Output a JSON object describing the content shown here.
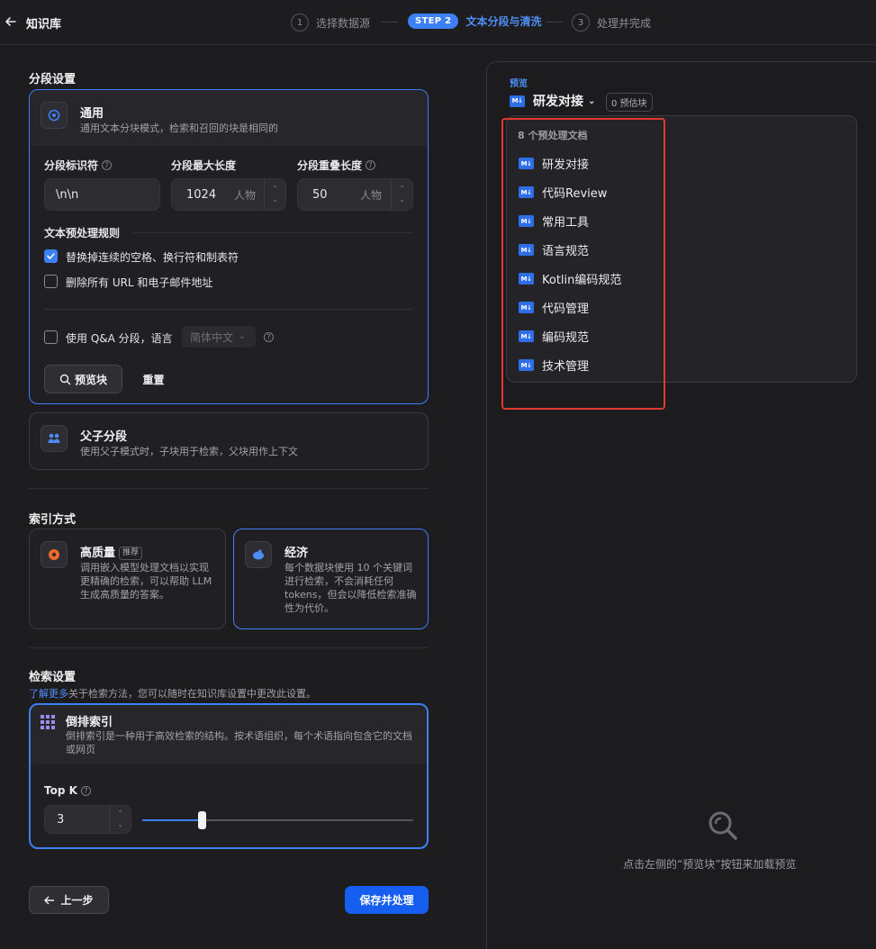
{
  "header": {
    "title": "知识库",
    "steps": [
      {
        "num": "1",
        "label": "选择数据源"
      },
      {
        "num": "STEP 2",
        "label": "文本分段与清洗"
      },
      {
        "num": "3",
        "label": "处理并完成"
      }
    ]
  },
  "segment": {
    "title": "分段设置",
    "general": {
      "title": "通用",
      "desc": "通用文本分块模式，检索和召回的块是相同的"
    },
    "fields": {
      "separator_label": "分段标识符",
      "separator_value": "\\n\\n",
      "max_len_label": "分段最大长度",
      "max_len_value": "1024",
      "overlap_label": "分段重叠长度",
      "overlap_value": "50",
      "unit": "人物"
    },
    "rules_title": "文本预处理规则",
    "rule1": "替换掉连续的空格、换行符和制表符",
    "rule2": "删除所有 URL 和电子邮件地址",
    "qa_label": "使用 Q&A 分段，语言",
    "qa_lang": "简体中文",
    "preview_btn": "预览块",
    "reset_btn": "重置",
    "parent_child": {
      "title": "父子分段",
      "desc": "使用父子模式时，子块用于检索，父块用作上下文"
    }
  },
  "index": {
    "title": "索引方式",
    "high": {
      "title": "高质量",
      "badge": "推荐",
      "desc": "调用嵌入模型处理文档以实现更精确的检索，可以帮助 LLM 生成高质量的答案。"
    },
    "eco": {
      "title": "经济",
      "desc": "每个数据块使用 10 个关键词进行检索，不会消耗任何 tokens，但会以降低检索准确性为代价。"
    }
  },
  "retrieval": {
    "title": "检索设置",
    "link": "了解更多",
    "note": "关于检索方法，您可以随时在知识库设置中更改此设置。",
    "inverted": {
      "title": "倒排索引",
      "desc": "倒排索引是一种用于高效检索的结构。按术语组织，每个术语指向包含它的文档或网页"
    },
    "topk_label": "Top K",
    "topk_value": "3",
    "topk_fraction": 0.22
  },
  "footer": {
    "prev": "上一步",
    "save": "保存并处理"
  },
  "preview": {
    "label": "预览",
    "selected_doc": "研发对接",
    "count_badge": "0 预估块",
    "list_header": "8 个预处理文档",
    "docs": [
      "研发对接",
      "代码Review",
      "常用工具",
      "语言规范",
      "Kotlin编码规范",
      "代码管理",
      "编码规范",
      "技术管理"
    ],
    "empty_hint": "点击左侧的“预览块”按钮来加载预览"
  },
  "colors": {
    "accent": "#3d7ff5",
    "primary_button": "#155eef",
    "highlight_box": "#e0392f"
  }
}
